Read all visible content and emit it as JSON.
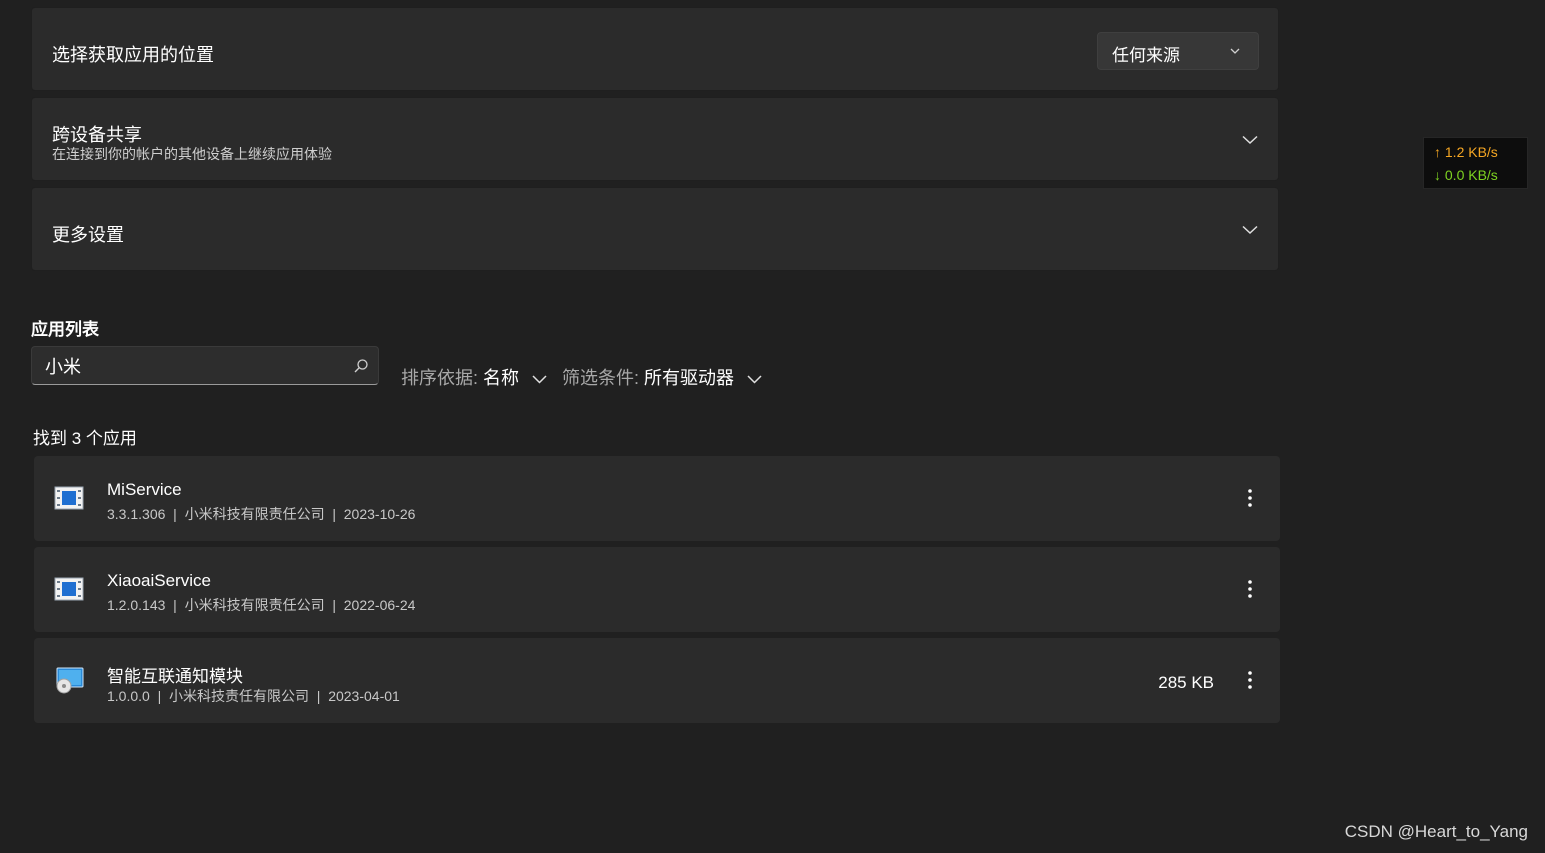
{
  "settings": {
    "install_source": {
      "title": "选择获取应用的位置",
      "dropdown_value": "任何来源"
    },
    "cross_device": {
      "title": "跨设备共享",
      "subtitle": "在连接到你的帐户的其他设备上继续应用体验"
    },
    "more_settings": {
      "title": "更多设置"
    }
  },
  "app_list": {
    "title": "应用列表",
    "search_value": "小米",
    "sort": {
      "label": "排序依据:",
      "value": "名称"
    },
    "filter": {
      "label": "筛选条件:",
      "value": "所有驱动器"
    },
    "found_text": "找到 3 个应用",
    "apps": [
      {
        "name": "MiService",
        "meta": "3.3.1.306  |  小米科技有限责任公司  |  2023-10-26",
        "size": "",
        "icon": "service-app-icon"
      },
      {
        "name": "XiaoaiService",
        "meta": "1.2.0.143  |  小米科技有限责任公司  |  2022-06-24",
        "size": "",
        "icon": "service-app-icon"
      },
      {
        "name": "智能互联通知模块",
        "meta": "1.0.0.0  |  小米科技责任有限公司  |  2023-04-01",
        "size": "285 KB",
        "icon": "installer-app-icon"
      }
    ]
  },
  "network_speed": {
    "upload": "↑ 1.2 KB/s",
    "download": "↓ 0.0 KB/s",
    "upload_color": "#f5a623",
    "download_color": "#7ed321"
  },
  "watermark": "CSDN @Heart_to_Yang"
}
